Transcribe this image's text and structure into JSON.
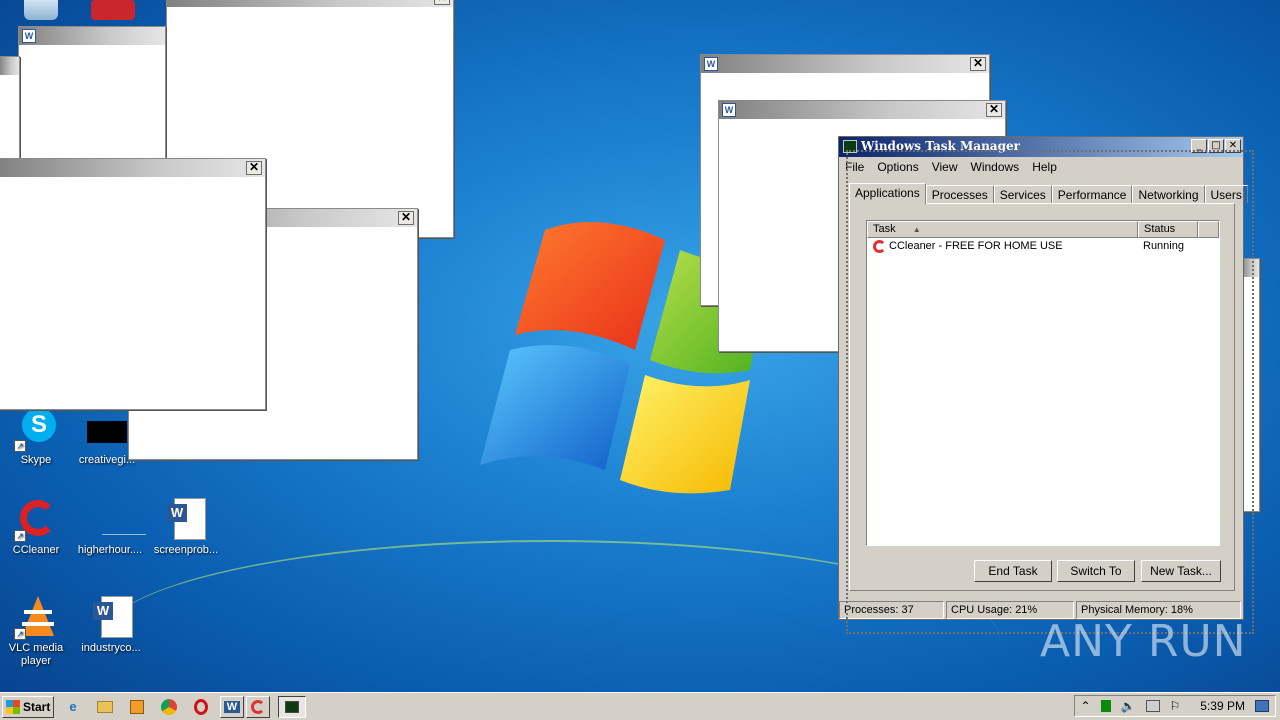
{
  "desktop_icons": [
    {
      "label": "Skype",
      "icon": "skype-icon"
    },
    {
      "label": "creativegi...",
      "icon": "black-image-icon"
    },
    {
      "label": "CCleaner",
      "icon": "ccleaner-icon"
    },
    {
      "label": "higherhour....",
      "icon": "blank-file-icon"
    },
    {
      "label": "screenprob...",
      "icon": "word-doc-icon"
    },
    {
      "label": "VLC media player",
      "icon": "vlc-icon"
    },
    {
      "label": "industryco...",
      "icon": "word-doc-icon"
    }
  ],
  "blank_window_close": "✕",
  "task_manager": {
    "title": "Windows Task Manager",
    "menu": [
      "File",
      "Options",
      "View",
      "Windows",
      "Help"
    ],
    "tabs": [
      "Applications",
      "Processes",
      "Services",
      "Performance",
      "Networking",
      "Users"
    ],
    "active_tab": "Applications",
    "columns": [
      "Task",
      "Status"
    ],
    "tasks": [
      {
        "name": "CCleaner - FREE FOR HOME USE",
        "status": "Running"
      }
    ],
    "buttons": {
      "end_task": "End Task",
      "switch_to": "Switch To",
      "new_task": "New Task..."
    },
    "status_bar": {
      "processes": "Processes: 37",
      "cpu": "CPU Usage: 21%",
      "memory": "Physical Memory: 18%"
    }
  },
  "watermark": "ANY RUN",
  "taskbar": {
    "start_label": "Start",
    "clock": "5:39 PM"
  }
}
